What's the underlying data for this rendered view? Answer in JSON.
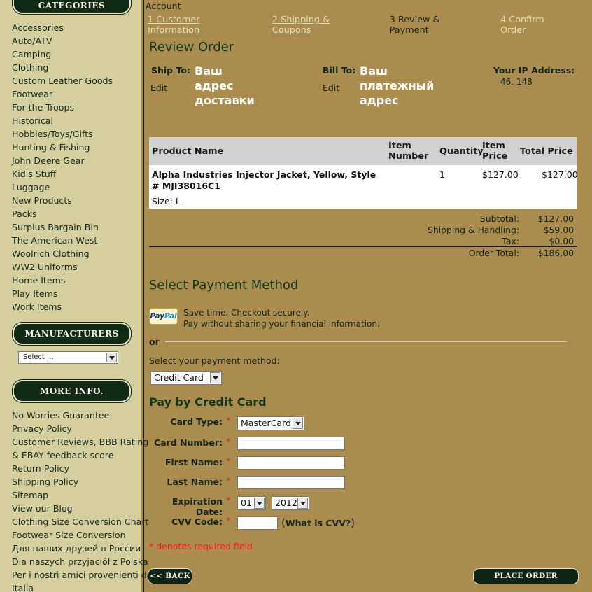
{
  "sidebar": {
    "categories_title": "CATEGORIES",
    "categories": [
      "Accessories",
      "Auto/ATV",
      "Camping",
      "Clothing",
      "Custom Leather Goods",
      "Footwear",
      "For the Troops",
      "Historical",
      "Hobbies/Toys/Gifts",
      "Hunting & Fishing",
      "John Deere Gear",
      "Kid's Stuff",
      "Luggage",
      "New Products",
      "Packs",
      "Surplus Bargain Bin",
      "The American West",
      "Woolrich Clothing",
      "WW2 Uniforms",
      "Home Items",
      "Play Items",
      "Work Items"
    ],
    "manufacturers_title": "MANUFACTURERS",
    "manufacturers_select": "Select ...",
    "more_title": "MORE INFO.",
    "more_links": [
      "No Worries Guarantee",
      "Privacy Policy",
      "Customer Reviews, BBB Rating",
      "& EBAY feedback score",
      "Return Policy",
      "Shipping Policy",
      "Sitemap",
      "View our Blog",
      "Clothing Size Conversion Chart",
      "Footwear Size Conversion",
      "Для наших друзей в России",
      "Dla naszych przyjaciół z Polska",
      "Per i nostri amici provenienti da",
      "Italia"
    ]
  },
  "header": {
    "account": "Account",
    "steps": [
      "1 Customer Information",
      "2 Shipping & Coupons",
      "3 Review & Payment",
      "4 Confirm Order"
    ]
  },
  "review": {
    "title": "Review Order",
    "ship_to": "Ship To:",
    "ship_edit": "Edit",
    "ship_lines": [
      "Ваш",
      "адрес",
      "доставки"
    ],
    "bill_to": "Bill To:",
    "bill_edit": "Edit",
    "bill_lines": [
      "Ваш",
      "платежный",
      "адрес"
    ],
    "ip_label": "Your IP Address:",
    "ip_value": "46.          148"
  },
  "table": {
    "headers": {
      "product": "Product Name",
      "item_number": [
        "Item",
        "Number"
      ],
      "quantity": "Quantity",
      "item_price": [
        "Item",
        "Price"
      ],
      "total": "Total Price"
    },
    "row": {
      "name_line1": "Alpha Industries Injector Jacket, Yellow, Style",
      "name_line2": "# MJI38016C1",
      "size": "Size: L",
      "qty": "1",
      "price": "$127.00",
      "total": "$127.00"
    }
  },
  "totals": {
    "subtotal_label": "Subtotal:",
    "subtotal": "$127.00",
    "shipping_label": "Shipping & Handling:",
    "shipping": "$59.00",
    "tax_label": "Tax:",
    "tax": "$0.00",
    "order_total_label": "Order Total:",
    "order_total": "$186.00"
  },
  "payment": {
    "title": "Select Payment Method",
    "paypal_logo_a": "Pay",
    "paypal_logo_b": "Pal",
    "paypal_line1": "Save time. Checkout securely.",
    "paypal_line2": "Pay without sharing your financial information.",
    "or": "or",
    "select_label": "Select your payment method:",
    "method": "Credit Card"
  },
  "card": {
    "title": "Pay by Credit Card",
    "type_label": "Card Type:",
    "type_value": "MasterCard",
    "number_label": "Card Number:",
    "first_label": "First Name:",
    "last_label": "Last Name:",
    "exp_label": "Expiration Date:",
    "exp_month": "01",
    "exp_year": "2012",
    "cvv_label": "CVV Code:",
    "cvv_help": "What is CVV?",
    "star": "*",
    "required_note": "* denotes required field"
  },
  "buttons": {
    "back": "<< BACK",
    "place": "PLACE ORDER"
  }
}
